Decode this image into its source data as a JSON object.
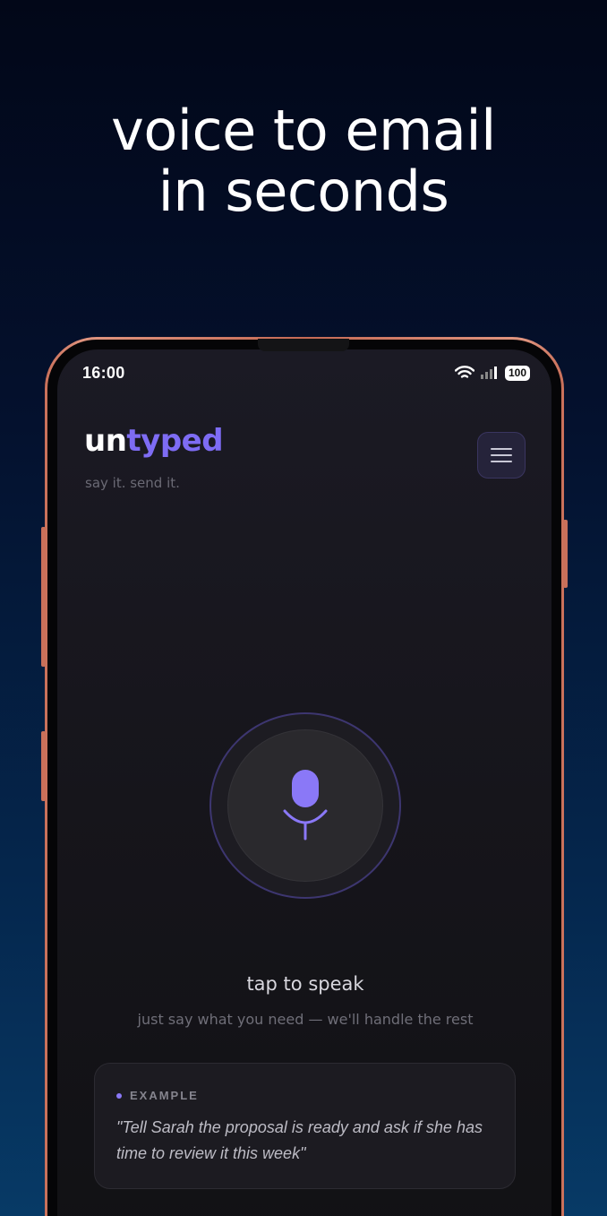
{
  "headline": {
    "line1": "voice to email",
    "line2": "in seconds"
  },
  "status_bar": {
    "time": "16:00",
    "battery": "100",
    "icons": [
      "wifi-icon",
      "signal-icon",
      "battery-icon"
    ]
  },
  "app": {
    "logo_part1": "un",
    "logo_part2": "typed",
    "tagline": "say it. send it.",
    "menu_icon": "hamburger-menu-icon"
  },
  "mic": {
    "icon": "microphone-icon",
    "label": "tap to speak",
    "sublabel": "just say what you need — we'll handle the rest"
  },
  "example": {
    "label": "EXAMPLE",
    "text": "\"Tell Sarah the proposal is ready and ask if she has time to review it this week\""
  },
  "colors": {
    "accent": "#7e6cf4",
    "frame": "#c9705a",
    "background": "#020718"
  }
}
